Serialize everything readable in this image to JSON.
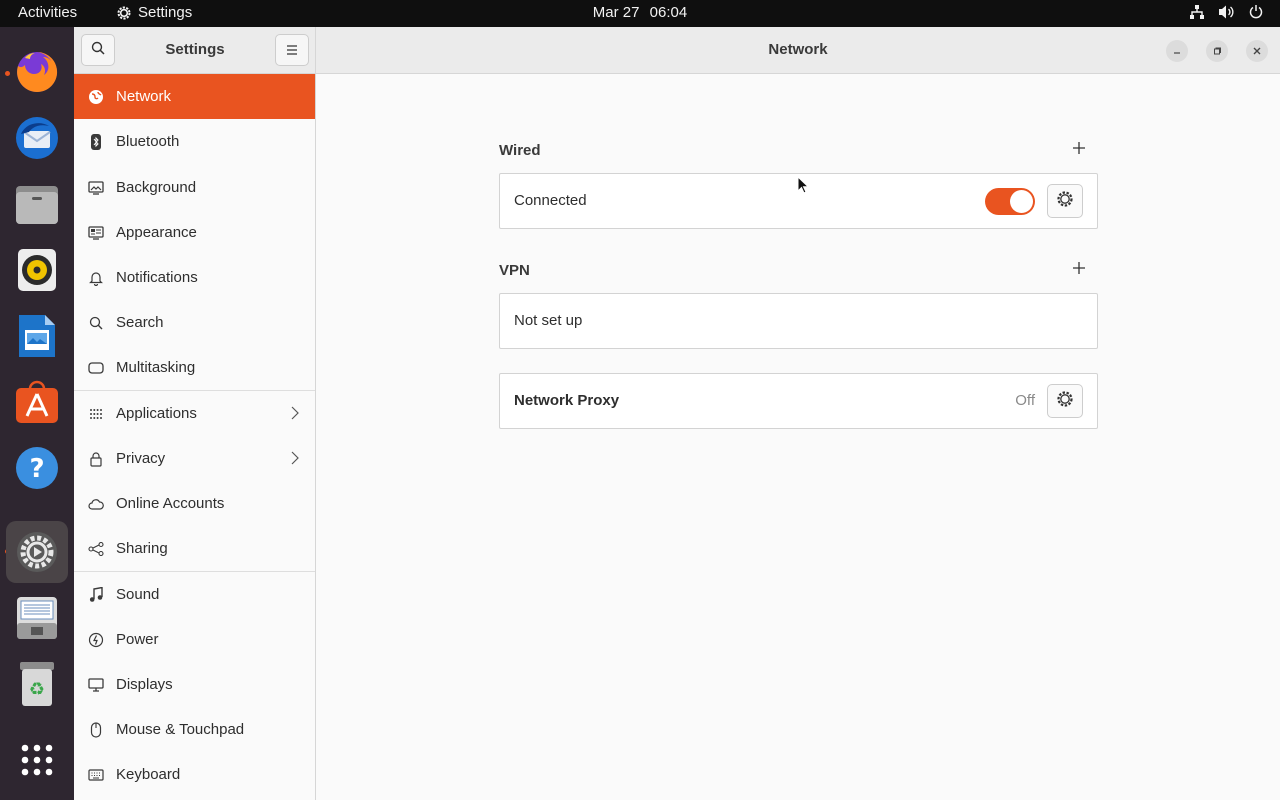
{
  "topbar": {
    "activities": "Activities",
    "app_name": "Settings",
    "date": "Mar 27",
    "time": "06:04",
    "tray_icons": [
      "network-icon",
      "volume-icon",
      "power-icon"
    ]
  },
  "dock": {
    "apps": [
      "firefox",
      "thunderbird",
      "files",
      "rhythmbox",
      "libreoffice-writer",
      "ubuntu-software",
      "help",
      "settings",
      "document-scanner",
      "trash",
      "show-applications"
    ]
  },
  "window": {
    "sidebar_title": "Settings",
    "content_title": "Network"
  },
  "sidebar": {
    "items": [
      {
        "label": "Network",
        "icon": "network-globe-icon"
      },
      {
        "label": "Bluetooth",
        "icon": "bluetooth-icon"
      },
      {
        "label": "Background",
        "icon": "background-icon"
      },
      {
        "label": "Appearance",
        "icon": "appearance-icon"
      },
      {
        "label": "Notifications",
        "icon": "bell-icon"
      },
      {
        "label": "Search",
        "icon": "search-icon"
      },
      {
        "label": "Multitasking",
        "icon": "multitasking-icon"
      },
      {
        "label": "Applications",
        "icon": "grid-icon"
      },
      {
        "label": "Privacy",
        "icon": "lock-icon"
      },
      {
        "label": "Online Accounts",
        "icon": "cloud-icon"
      },
      {
        "label": "Sharing",
        "icon": "share-icon"
      },
      {
        "label": "Sound",
        "icon": "music-note-icon"
      },
      {
        "label": "Power",
        "icon": "power-icon"
      },
      {
        "label": "Displays",
        "icon": "display-icon"
      },
      {
        "label": "Mouse & Touchpad",
        "icon": "mouse-icon"
      },
      {
        "label": "Keyboard",
        "icon": "keyboard-icon"
      }
    ]
  },
  "network": {
    "wired": {
      "title": "Wired",
      "status": "Connected",
      "enabled": true
    },
    "vpn": {
      "title": "VPN",
      "status": "Not set up"
    },
    "proxy": {
      "title": "Network Proxy",
      "state": "Off"
    }
  },
  "colors": {
    "accent": "#e95420"
  }
}
